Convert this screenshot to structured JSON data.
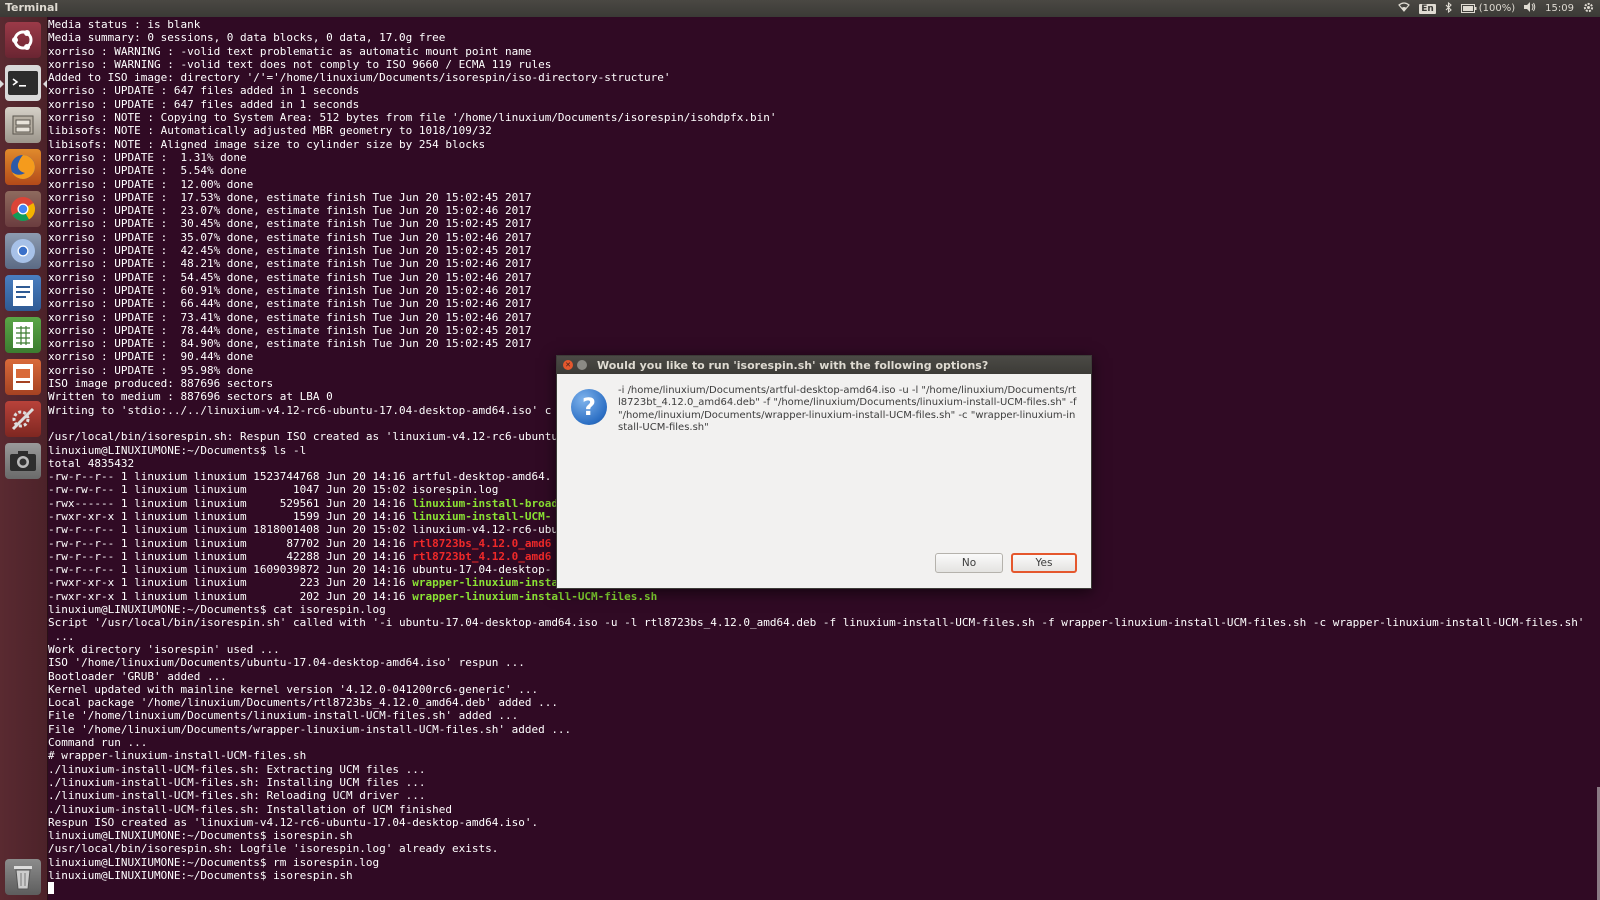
{
  "panel": {
    "app_title": "Terminal",
    "tray": {
      "keyboard_layout": "En",
      "battery_label": "(100%)",
      "clock": "15:09",
      "icons": [
        "wifi-icon",
        "keyboard-indicator",
        "bluetooth-icon",
        "battery-icon",
        "volume-icon",
        "clock",
        "settings-gear-icon"
      ]
    }
  },
  "launcher": {
    "items": [
      {
        "name": "dash-home",
        "icon": "ubuntu-logo-icon"
      },
      {
        "name": "terminal",
        "icon": "terminal-icon",
        "active": true
      },
      {
        "name": "files",
        "icon": "file-cabinet-icon"
      },
      {
        "name": "firefox",
        "icon": "firefox-icon"
      },
      {
        "name": "chrome",
        "icon": "chrome-icon"
      },
      {
        "name": "chromium",
        "icon": "chromium-icon"
      },
      {
        "name": "libreoffice-writer",
        "icon": "writer-icon"
      },
      {
        "name": "libreoffice-calc",
        "icon": "calc-icon"
      },
      {
        "name": "libreoffice-impress",
        "icon": "impress-icon"
      },
      {
        "name": "system-settings",
        "icon": "settings-tools-icon"
      },
      {
        "name": "camera",
        "icon": "camera-icon"
      },
      {
        "name": "trash",
        "icon": "trash-icon"
      }
    ]
  },
  "terminal": {
    "text_color": "#ffffff",
    "background": "#300a24",
    "executable_color": "#8ae234",
    "archive_color": "#ef2929",
    "lines": [
      {
        "t": "Media status : is blank"
      },
      {
        "t": "Media summary: 0 sessions, 0 data blocks, 0 data, 17.0g free"
      },
      {
        "t": "xorriso : WARNING : -volid text problematic as automatic mount point name"
      },
      {
        "t": "xorriso : WARNING : -volid text does not comply to ISO 9660 / ECMA 119 rules"
      },
      {
        "t": "Added to ISO image: directory '/'='/home/linuxium/Documents/isorespin/iso-directory-structure'"
      },
      {
        "t": "xorriso : UPDATE : 647 files added in 1 seconds"
      },
      {
        "t": "xorriso : UPDATE : 647 files added in 1 seconds"
      },
      {
        "t": "xorriso : NOTE : Copying to System Area: 512 bytes from file '/home/linuxium/Documents/isorespin/isohdpfx.bin'"
      },
      {
        "t": "libisofs: NOTE : Automatically adjusted MBR geometry to 1018/109/32"
      },
      {
        "t": "libisofs: NOTE : Aligned image size to cylinder size by 254 blocks"
      },
      {
        "t": "xorriso : UPDATE :  1.31% done"
      },
      {
        "t": "xorriso : UPDATE :  5.54% done"
      },
      {
        "t": "xorriso : UPDATE :  12.00% done"
      },
      {
        "t": "xorriso : UPDATE :  17.53% done, estimate finish Tue Jun 20 15:02:45 2017"
      },
      {
        "t": "xorriso : UPDATE :  23.07% done, estimate finish Tue Jun 20 15:02:46 2017"
      },
      {
        "t": "xorriso : UPDATE :  30.45% done, estimate finish Tue Jun 20 15:02:45 2017"
      },
      {
        "t": "xorriso : UPDATE :  35.07% done, estimate finish Tue Jun 20 15:02:46 2017"
      },
      {
        "t": "xorriso : UPDATE :  42.45% done, estimate finish Tue Jun 20 15:02:45 2017"
      },
      {
        "t": "xorriso : UPDATE :  48.21% done, estimate finish Tue Jun 20 15:02:46 2017"
      },
      {
        "t": "xorriso : UPDATE :  54.45% done, estimate finish Tue Jun 20 15:02:46 2017"
      },
      {
        "t": "xorriso : UPDATE :  60.91% done, estimate finish Tue Jun 20 15:02:46 2017"
      },
      {
        "t": "xorriso : UPDATE :  66.44% done, estimate finish Tue Jun 20 15:02:46 2017"
      },
      {
        "t": "xorriso : UPDATE :  73.41% done, estimate finish Tue Jun 20 15:02:46 2017"
      },
      {
        "t": "xorriso : UPDATE :  78.44% done, estimate finish Tue Jun 20 15:02:45 2017"
      },
      {
        "t": "xorriso : UPDATE :  84.90% done, estimate finish Tue Jun 20 15:02:45 2017"
      },
      {
        "t": "xorriso : UPDATE :  90.44% done"
      },
      {
        "t": "xorriso : UPDATE :  95.98% done"
      },
      {
        "t": "ISO image produced: 887696 sectors"
      },
      {
        "t": "Written to medium : 887696 sectors at LBA 0"
      },
      {
        "t": "Writing to 'stdio:../../linuxium-v4.12-rc6-ubuntu-17.04-desktop-amd64.iso' c"
      },
      {
        "t": ""
      },
      {
        "t": "/usr/local/bin/isorespin.sh: Respun ISO created as 'linuxium-v4.12-rc6-ubuntu"
      },
      {
        "t": "linuxium@LINUXIUMONE:~/Documents$ ls -l"
      },
      {
        "t": "total 4835432"
      },
      {
        "t": "-rw-r--r-- 1 linuxium linuxium 1523744768 Jun 20 14:16 ",
        "f": "artful-desktop-amd64.",
        "c": ""
      },
      {
        "t": "-rw-rw-r-- 1 linuxium linuxium       1047 Jun 20 15:02 ",
        "f": "isorespin.log",
        "c": ""
      },
      {
        "t": "-rwx------ 1 linuxium linuxium     529561 Jun 20 14:16 ",
        "f": "linuxium-install-broad",
        "c": "green"
      },
      {
        "t": "-rwxr-xr-x 1 linuxium linuxium       1599 Jun 20 14:16 ",
        "f": "linuxium-install-UCM-",
        "c": "green"
      },
      {
        "t": "-rw-r--r-- 1 linuxium linuxium 1818001408 Jun 20 15:02 ",
        "f": "linuxium-v4.12-rc6-ubu",
        "c": ""
      },
      {
        "t": "-rw-r--r-- 1 linuxium linuxium      87702 Jun 20 14:16 ",
        "f": "rtl8723bs_4.12.0_amd6",
        "c": "red"
      },
      {
        "t": "-rw-r--r-- 1 linuxium linuxium      42288 Jun 20 14:16 ",
        "f": "rtl8723bt_4.12.0_amd6",
        "c": "red"
      },
      {
        "t": "-rw-r--r-- 1 linuxium linuxium 1609039872 Jun 20 14:16 ",
        "f": "ubuntu-17.04-desktop-",
        "c": ""
      },
      {
        "t": "-rwxr-xr-x 1 linuxium linuxium        223 Jun 20 14:16 ",
        "f": "wrapper-linuxium-install-broadcom-drivers.sh",
        "c": "green"
      },
      {
        "t": "-rwxr-xr-x 1 linuxium linuxium        202 Jun 20 14:16 ",
        "f": "wrapper-linuxium-install-UCM-files.sh",
        "c": "green"
      },
      {
        "t": "linuxium@LINUXIUMONE:~/Documents$ cat isorespin.log"
      },
      {
        "t": "Script '/usr/local/bin/isorespin.sh' called with '-i ubuntu-17.04-desktop-amd64.iso -u -l rtl8723bs_4.12.0_amd64.deb -f linuxium-install-UCM-files.sh -f wrapper-linuxium-install-UCM-files.sh -c wrapper-linuxium-install-UCM-files.sh'"
      },
      {
        "t": " ..."
      },
      {
        "t": "Work directory 'isorespin' used ..."
      },
      {
        "t": "ISO '/home/linuxium/Documents/ubuntu-17.04-desktop-amd64.iso' respun ..."
      },
      {
        "t": "Bootloader 'GRUB' added ..."
      },
      {
        "t": "Kernel updated with mainline kernel version '4.12.0-041200rc6-generic' ..."
      },
      {
        "t": "Local package '/home/linuxium/Documents/rtl8723bs_4.12.0_amd64.deb' added ..."
      },
      {
        "t": "File '/home/linuxium/Documents/linuxium-install-UCM-files.sh' added ..."
      },
      {
        "t": "File '/home/linuxium/Documents/wrapper-linuxium-install-UCM-files.sh' added ..."
      },
      {
        "t": "Command run ..."
      },
      {
        "t": "# wrapper-linuxium-install-UCM-files.sh"
      },
      {
        "t": "./linuxium-install-UCM-files.sh: Extracting UCM files ..."
      },
      {
        "t": "./linuxium-install-UCM-files.sh: Installing UCM files ..."
      },
      {
        "t": "./linuxium-install-UCM-files.sh: Reloading UCM driver ..."
      },
      {
        "t": "./linuxium-install-UCM-files.sh: Installation of UCM finished"
      },
      {
        "t": "Respun ISO created as 'linuxium-v4.12-rc6-ubuntu-17.04-desktop-amd64.iso'."
      },
      {
        "t": "linuxium@LINUXIUMONE:~/Documents$ isorespin.sh"
      },
      {
        "t": "/usr/local/bin/isorespin.sh: Logfile 'isorespin.log' already exists."
      },
      {
        "t": "linuxium@LINUXIUMONE:~/Documents$ rm isorespin.log"
      },
      {
        "t": "linuxium@LINUXIUMONE:~/Documents$ isorespin.sh"
      }
    ]
  },
  "dialog": {
    "title": "Would you like to run 'isorespin.sh' with the following options?",
    "message": " -i /home/linuxium/Documents/artful-desktop-amd64.iso -u -l \"/home/linuxium/Documents/rtl8723bt_4.12.0_amd64.deb\" -f \"/home/linuxium/Documents/linuxium-install-UCM-files.sh\" -f \"/home/linuxium/Documents/wrapper-linuxium-install-UCM-files.sh\" -c \"wrapper-linuxium-install-UCM-files.sh\"",
    "icon": "question-icon",
    "no_label": "No",
    "yes_label": "Yes",
    "default_button_color": "#e5572d"
  }
}
